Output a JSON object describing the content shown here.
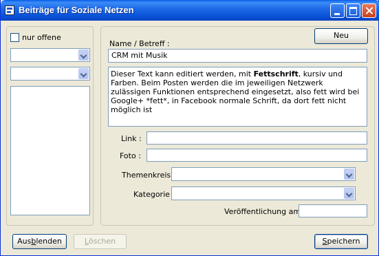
{
  "window": {
    "title": "Beiträge für Soziale Netzen"
  },
  "filter": {
    "only_open_label": "nur offene",
    "only_open_checked": false,
    "combo1_value": "",
    "combo2_value": "",
    "list_items": []
  },
  "form": {
    "new_button": "Neu",
    "name_label": "Name / Betreff :",
    "name_value": "CRM mit Musik",
    "text_parts": {
      "before": "Dieser Text kann editiert werden, mit ",
      "bold": "Fettschrift",
      "after": ", kursiv und Farben. Beim Posten werden die im jeweiligen Netzwerk zulässigen Funktionen entsprechend eingesetzt, also fett wird bei Google+ *fett*, in Facebook normale Schrift, da dort fett nicht möglich ist"
    },
    "link_label": "Link :",
    "link_value": "",
    "foto_label": "Foto :",
    "foto_value": "",
    "themenkreis_label": "Themenkreis :",
    "themenkreis_value": "",
    "kategorie_label": "Kategorie :",
    "kategorie_value": "",
    "publish_label": "Veröffentlichung am :",
    "publish_value": ""
  },
  "footer": {
    "hide_prefix": "Aus",
    "hide_mnemonic": "b",
    "hide_suffix": "lenden",
    "delete_mnemonic": "L",
    "delete_suffix": "öschen",
    "save_mnemonic": "S",
    "save_suffix": "peichern"
  }
}
